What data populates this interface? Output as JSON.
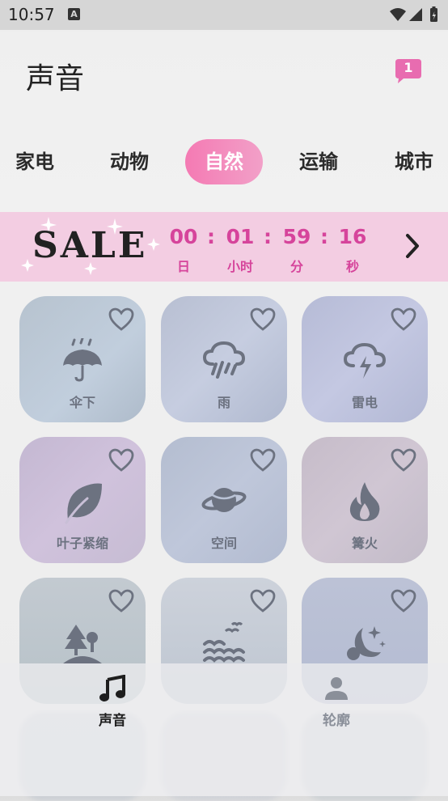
{
  "status_bar": {
    "time": "10:57",
    "notif_letter": "A"
  },
  "header": {
    "title": "声音",
    "message_count": "1"
  },
  "categories": [
    "家电",
    "动物",
    "自然",
    "运输",
    "城市"
  ],
  "active_category": "自然",
  "sale_banner": {
    "label": "SALE",
    "countdown": [
      {
        "value": "00",
        "unit": "日"
      },
      {
        "value": "01",
        "unit": "小时"
      },
      {
        "value": "59",
        "unit": "分"
      },
      {
        "value": "16",
        "unit": "秒"
      }
    ],
    "separator": ":"
  },
  "sounds": [
    {
      "label": "伞下",
      "icon": "umbrella-rain-icon"
    },
    {
      "label": "雨",
      "icon": "cloud-rain-icon"
    },
    {
      "label": "雷电",
      "icon": "cloud-lightning-icon"
    },
    {
      "label": "叶子紧缩",
      "icon": "leaf-icon"
    },
    {
      "label": "空间",
      "icon": "planet-icon"
    },
    {
      "label": "篝火",
      "icon": "fire-icon"
    },
    {
      "label": "",
      "icon": "forest-icon"
    },
    {
      "label": "",
      "icon": "water-waves-icon"
    },
    {
      "label": "",
      "icon": "moon-stars-icon"
    }
  ],
  "bottom_nav": [
    {
      "label": "声音",
      "icon": "music-note-icon",
      "active": true
    },
    {
      "label": "轮廓",
      "icon": "person-icon",
      "active": false
    }
  ],
  "colors": {
    "accent": "#f47ab3",
    "countdown": "#d6449b",
    "banner_bg": "#f3cde2"
  }
}
